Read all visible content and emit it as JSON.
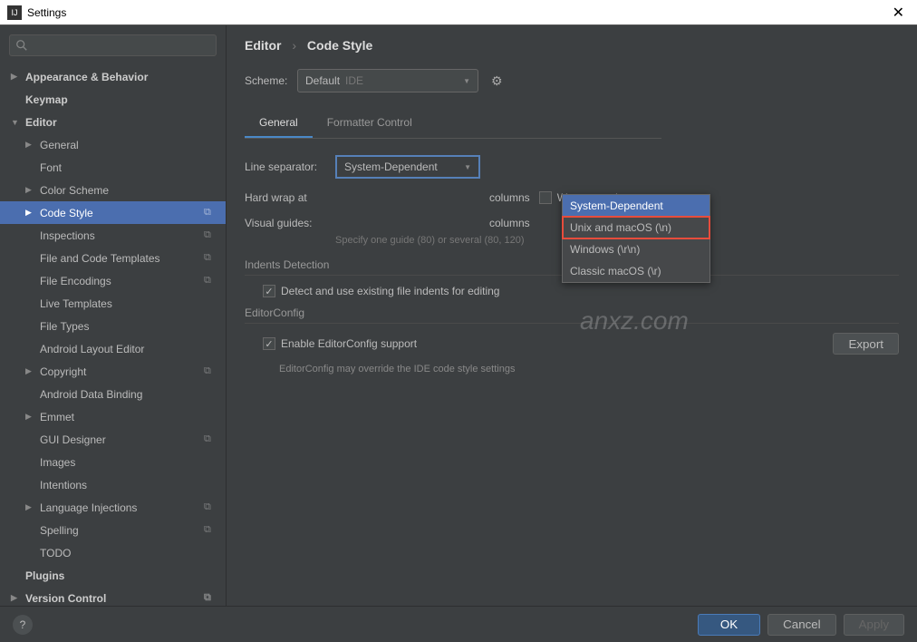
{
  "window": {
    "title": "Settings"
  },
  "breadcrumb": {
    "a": "Editor",
    "b": "Code Style"
  },
  "scheme": {
    "label": "Scheme:",
    "value": "Default",
    "tag": "IDE"
  },
  "tabs": {
    "general": "General",
    "formatter": "Formatter Control"
  },
  "lineSep": {
    "label": "Line separator:",
    "value": "System-Dependent",
    "options": [
      "System-Dependent",
      "Unix and macOS (\\n)",
      "Windows (\\r\\n)",
      "Classic macOS (\\r)"
    ]
  },
  "hardWrap": {
    "label": "Hard wrap at",
    "columns": "columns",
    "wrapTyping": "Wrap on typing"
  },
  "visualGuides": {
    "label": "Visual guides:",
    "columns": "columns",
    "hint": "Specify one guide (80) or several (80, 120)"
  },
  "indents": {
    "title": "Indents Detection",
    "check": "Detect and use existing file indents for editing"
  },
  "editorConfig": {
    "title": "EditorConfig",
    "check": "Enable EditorConfig support",
    "hint": "EditorConfig may override the IDE code style settings",
    "export": "Export"
  },
  "sidebar": [
    {
      "label": "Appearance & Behavior",
      "bold": true,
      "arrow": "▶",
      "indent": 0
    },
    {
      "label": "Keymap",
      "bold": true,
      "indent": 0,
      "arrow": ""
    },
    {
      "label": "Editor",
      "bold": true,
      "arrow": "▼",
      "indent": 0
    },
    {
      "label": "General",
      "arrow": "▶",
      "indent": 1
    },
    {
      "label": "Font",
      "indent": 1,
      "arrow": ""
    },
    {
      "label": "Color Scheme",
      "arrow": "▶",
      "indent": 1
    },
    {
      "label": "Code Style",
      "arrow": "▶",
      "indent": 1,
      "selected": true,
      "copy": true
    },
    {
      "label": "Inspections",
      "indent": 1,
      "copy": true,
      "arrow": ""
    },
    {
      "label": "File and Code Templates",
      "indent": 1,
      "copy": true,
      "arrow": ""
    },
    {
      "label": "File Encodings",
      "indent": 1,
      "copy": true,
      "arrow": ""
    },
    {
      "label": "Live Templates",
      "indent": 1,
      "arrow": ""
    },
    {
      "label": "File Types",
      "indent": 1,
      "arrow": ""
    },
    {
      "label": "Android Layout Editor",
      "indent": 1,
      "arrow": ""
    },
    {
      "label": "Copyright",
      "arrow": "▶",
      "indent": 1,
      "copy": true
    },
    {
      "label": "Android Data Binding",
      "indent": 1,
      "arrow": ""
    },
    {
      "label": "Emmet",
      "arrow": "▶",
      "indent": 1
    },
    {
      "label": "GUI Designer",
      "indent": 1,
      "copy": true,
      "arrow": ""
    },
    {
      "label": "Images",
      "indent": 1,
      "arrow": ""
    },
    {
      "label": "Intentions",
      "indent": 1,
      "arrow": ""
    },
    {
      "label": "Language Injections",
      "arrow": "▶",
      "indent": 1,
      "copy": true
    },
    {
      "label": "Spelling",
      "indent": 1,
      "copy": true,
      "arrow": ""
    },
    {
      "label": "TODO",
      "indent": 1,
      "arrow": ""
    },
    {
      "label": "Plugins",
      "bold": true,
      "indent": 0,
      "arrow": ""
    },
    {
      "label": "Version Control",
      "bold": true,
      "arrow": "▶",
      "indent": 0,
      "copy": true
    }
  ],
  "buttons": {
    "ok": "OK",
    "cancel": "Cancel",
    "apply": "Apply"
  }
}
